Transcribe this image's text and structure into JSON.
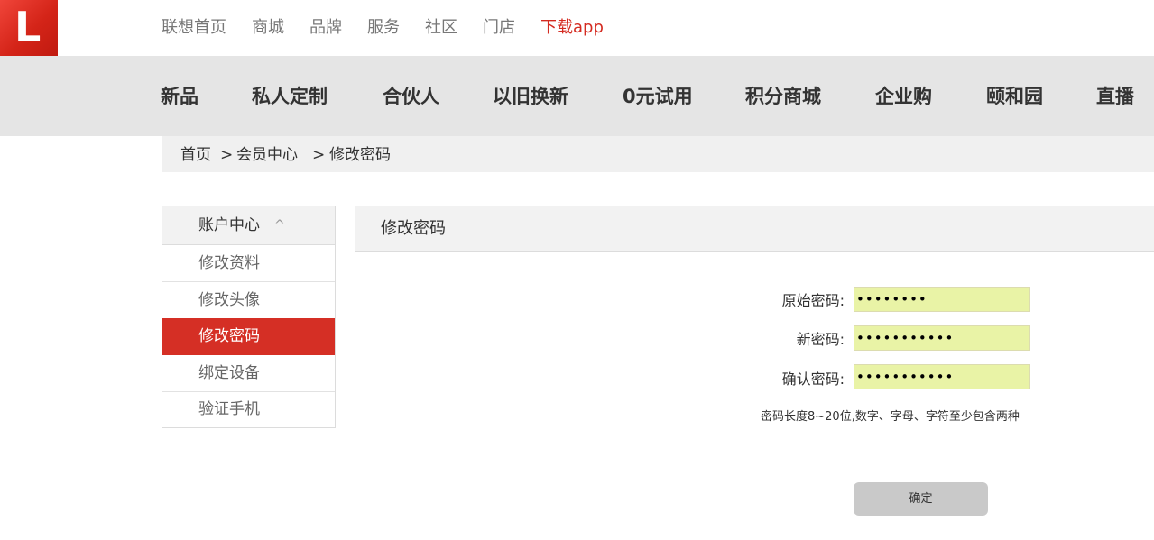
{
  "logo": {
    "glyph": "L"
  },
  "top_nav": [
    {
      "label": "联想首页"
    },
    {
      "label": "商城"
    },
    {
      "label": "品牌"
    },
    {
      "label": "服务"
    },
    {
      "label": "社区"
    },
    {
      "label": "门店"
    },
    {
      "label": "下载app",
      "highlight": true
    }
  ],
  "main_nav": [
    {
      "label": "新品"
    },
    {
      "label": "私人定制"
    },
    {
      "label": "合伙人"
    },
    {
      "label": "以旧换新"
    },
    {
      "label": "0元试用"
    },
    {
      "label": "积分商城"
    },
    {
      "label": "企业购"
    },
    {
      "label": "颐和园"
    },
    {
      "label": "直播"
    }
  ],
  "breadcrumb": {
    "home": "首页",
    "sep1": ">",
    "member_center": "会员中心",
    "sep2": ">",
    "current": "修改密码"
  },
  "sidebar": {
    "header": "账户中心",
    "caret": "^",
    "items": [
      {
        "label": "修改资料"
      },
      {
        "label": "修改头像"
      },
      {
        "label": "修改密码",
        "active": true
      },
      {
        "label": "绑定设备"
      },
      {
        "label": "验证手机"
      }
    ]
  },
  "panel": {
    "title": "修改密码",
    "fields": {
      "old": {
        "label": "原始密码:",
        "masked_value": "••••••••"
      },
      "new": {
        "label": "新密码:",
        "masked_value": "•••••••••••"
      },
      "confirm": {
        "label": "确认密码:",
        "masked_value": "•••••••••••"
      }
    },
    "hint": "密码长度8~20位,数字、字母、字符至少包含两种",
    "submit_label": "确定"
  },
  "colors": {
    "brand_red": "#d52f25",
    "input_bg": "#e9f3a6",
    "nav_bg": "#e5e5e5"
  }
}
